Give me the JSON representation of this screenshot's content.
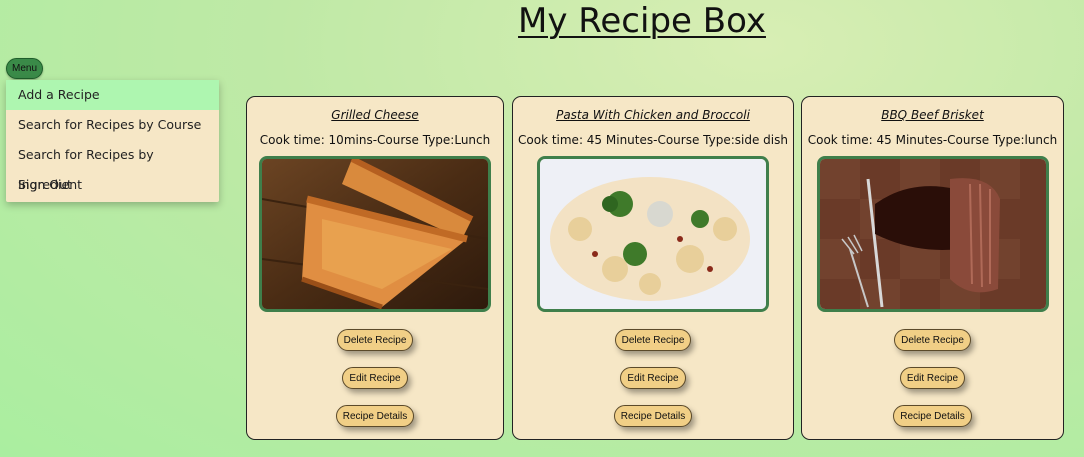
{
  "header": {
    "title": "My Recipe Box"
  },
  "menu": {
    "button_label": "Menu",
    "items": [
      {
        "label": "Add a Recipe"
      },
      {
        "label": "Search for Recipes by Course"
      },
      {
        "label": "Search for Recipes by Ingredient"
      },
      {
        "label": "Sign Out"
      }
    ]
  },
  "recipes": [
    {
      "title": "Grilled Cheese",
      "meta": "Cook time: 10mins-Course Type:Lunch",
      "image": "grilled-cheese-photo"
    },
    {
      "title": "Pasta With Chicken and Broccoli",
      "meta": "Cook time: 45 Minutes-Course Type:side dish",
      "image": "pasta-photo"
    },
    {
      "title": "BBQ Beef Brisket",
      "meta": "Cook time: 45 Minutes-Course Type:lunch",
      "image": "brisket-photo"
    }
  ],
  "buttons": {
    "delete": "Delete Recipe",
    "edit": "Edit Recipe",
    "details": "Recipe Details"
  },
  "colors": {
    "background": "#bfe9a6",
    "card": "#f6e7c6",
    "menu_active": "#aef6b0",
    "photo_border": "#3f7f4b",
    "button": "#f1cf86",
    "menu_button": "#3a8a48"
  }
}
